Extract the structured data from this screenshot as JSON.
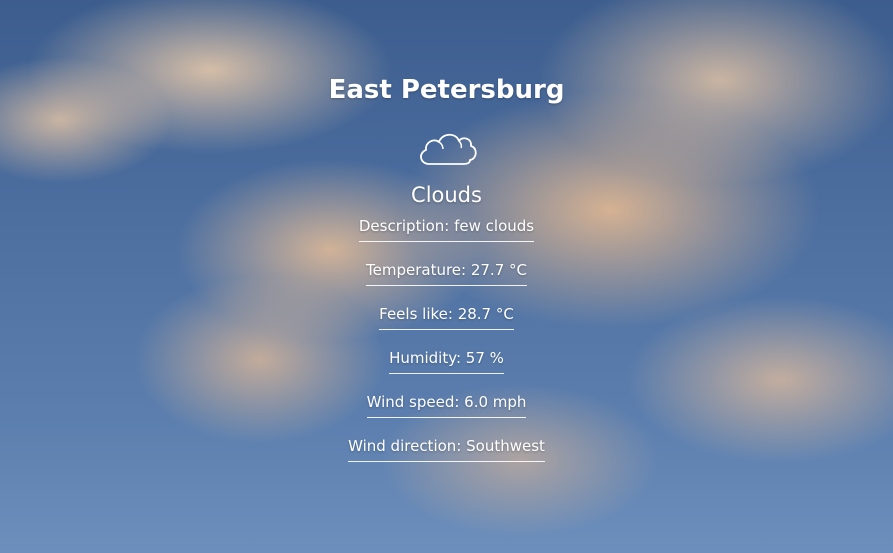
{
  "weather": {
    "city": "East Petersburg",
    "icon": "cloud-icon",
    "main": "Clouds",
    "details": [
      {
        "label": "Description",
        "value": "few clouds",
        "text": "Description: few clouds"
      },
      {
        "label": "Temperature",
        "value": "27.7 °C",
        "text": "Temperature: 27.7 °C"
      },
      {
        "label": "Feels like",
        "value": "28.7 °C",
        "text": "Feels like: 28.7 °C"
      },
      {
        "label": "Humidity",
        "value": "57 %",
        "text": "Humidity: 57 %"
      },
      {
        "label": "Wind speed",
        "value": "6.0 mph",
        "text": "Wind speed: 6.0 mph"
      },
      {
        "label": "Wind direction",
        "value": "Southwest",
        "text": "Wind direction: Southwest"
      }
    ]
  },
  "colors": {
    "text": "#ffffff",
    "sky": "#4d6fa0",
    "clouds": "#e4b991"
  }
}
